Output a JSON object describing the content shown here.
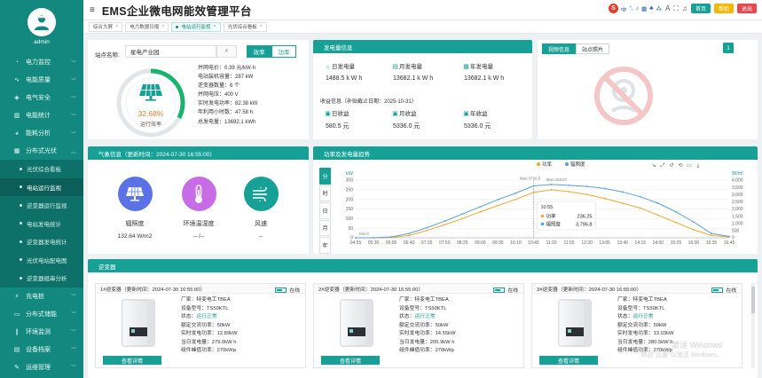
{
  "user": {
    "name": "admin"
  },
  "app": {
    "title": "EMS企业微电网能效管理平台"
  },
  "sidebar": {
    "items": [
      {
        "label": "电力监控",
        "icon": "gauge-icon"
      },
      {
        "label": "电能质量",
        "icon": "wave-icon"
      },
      {
        "label": "电气安全",
        "icon": "shield-icon"
      },
      {
        "label": "电能统计",
        "icon": "bar-chart-icon"
      },
      {
        "label": "能耗分析",
        "icon": "pie-icon"
      },
      {
        "label": "分布式光伏",
        "icon": "solar-icon",
        "expanded": true
      }
    ],
    "pv_sub": [
      {
        "label": "光伏综合看板"
      },
      {
        "label": "电站运行监视",
        "active": true
      },
      {
        "label": "逆变器运行监视"
      },
      {
        "label": "电站发电统计"
      },
      {
        "label": "逆变器发电统计"
      },
      {
        "label": "光伏电站配电图"
      },
      {
        "label": "逆变器组串分析"
      }
    ],
    "items_after": [
      {
        "label": "充电桩",
        "icon": "charger-icon"
      },
      {
        "label": "分布式储能",
        "icon": "battery-icon"
      },
      {
        "label": "环境监测",
        "icon": "thermometer-icon"
      },
      {
        "label": "设备档案",
        "icon": "archive-icon"
      },
      {
        "label": "运维管理",
        "icon": "wrench-icon"
      }
    ]
  },
  "topbar": {
    "ime_label": "中",
    "buttons": [
      {
        "label": "首页",
        "color": "#17a096"
      },
      {
        "label": "帮助",
        "color": "#f5b800"
      },
      {
        "label": "退出",
        "color": "#e5484d"
      }
    ]
  },
  "tabs": [
    {
      "label": "综合大屏"
    },
    {
      "label": "电力数据日报"
    },
    {
      "label": "电站运行监视",
      "active": true
    },
    {
      "label": "光伏综合看板"
    }
  ],
  "station": {
    "label": "站点名称:",
    "name": "星电产业园",
    "seg_efficiency": "效率",
    "seg_power": "功率",
    "efficiency": 32.68,
    "efficiency_text": "32.68%",
    "efficiency_label": "运行效率",
    "info": [
      "并网电价：0.39 元/kW·h",
      "电站装机容量：287 kW",
      "逆变器数量：6 个",
      "并网电压：400 V",
      "实时发电功率：82.38 kW",
      "年利用小时数：47.58 h",
      "总发电量：13682.1 kWh"
    ]
  },
  "power_info": {
    "title": "发电量信息",
    "gen": [
      {
        "label": "日发电量",
        "value": "1488.5 k W h"
      },
      {
        "label": "月发电量",
        "value": "13682.1 k W h"
      },
      {
        "label": "年发电量",
        "value": "13682.1 k W h"
      }
    ],
    "income_title": "收益信息（补贴截止日期：2025-10-31）",
    "income": [
      {
        "label": "日收益",
        "value": "580.5 元"
      },
      {
        "label": "月收益",
        "value": "5336.0 元"
      },
      {
        "label": "年收益",
        "value": "5336.0 元"
      }
    ]
  },
  "video": {
    "tab_info": "视频信息",
    "tab_photo": "站点照片",
    "badge": "1"
  },
  "weather": {
    "title": "气象信息（更新时间：2024-07-30 16:55:00）",
    "items": [
      {
        "name": "辐照度",
        "value": "132.64 W/m2",
        "color": "#5b72e6"
      },
      {
        "name": "环境温湿度",
        "value": "-- /--",
        "color": "#c86be6"
      },
      {
        "name": "风速",
        "value": "--",
        "color": "#17a096"
      }
    ]
  },
  "chart_panel": {
    "title": "功率及发电量趋势",
    "side_tabs": [
      "分",
      "时",
      "日",
      "月",
      "年"
    ],
    "tooltip_time": "10:55",
    "tooltip_power_label": "功率",
    "tooltip_power": "236.25",
    "tooltip_irr_label": "辐照度",
    "tooltip_irr": "3,796.8",
    "max_a": "Max:3796.8",
    "max_b": "Max:259.07",
    "min_a": "Min:0"
  },
  "chart_data": {
    "type": "line",
    "x": [
      "04:55",
      "05:30",
      "06:05",
      "06:40",
      "07:15",
      "07:50",
      "08:25",
      "09:00",
      "09:35",
      "10:10",
      "10:45",
      "11:20",
      "11:55",
      "12:30",
      "13:05",
      "13:40",
      "14:15",
      "14:50",
      "15:25",
      "16:00",
      "16:35",
      "16:45"
    ],
    "series": [
      {
        "name": "功率",
        "axis": "left",
        "unit": "kW",
        "color": "#f0a830",
        "values": [
          0,
          0,
          2,
          12,
          38,
          68,
          100,
          135,
          168,
          200,
          236,
          250,
          240,
          225,
          205,
          180,
          155,
          118,
          80,
          42,
          12,
          4
        ]
      },
      {
        "name": "辐照度",
        "axis": "right",
        "unit": "W/m²",
        "color": "#5aa0d8",
        "values": [
          0,
          0,
          60,
          300,
          700,
          1150,
          1650,
          2150,
          2650,
          3100,
          3600,
          3700,
          3640,
          3560,
          3420,
          3180,
          2850,
          2400,
          1800,
          1100,
          300,
          100
        ]
      }
    ],
    "ylabel_left": "kW",
    "ylabel_right": "W/m²",
    "ylim_left": [
      0,
      300
    ],
    "ylim_right": [
      0,
      4000
    ],
    "yticks_left": [
      0,
      50,
      100,
      150,
      200,
      250,
      300
    ],
    "yticks_right": [
      0,
      500,
      1000,
      1500,
      2000,
      2500,
      3000,
      3500,
      4000
    ],
    "legend": "top",
    "grid": true
  },
  "inverters": {
    "title": "逆变器",
    "online_label": "在线",
    "detail_label": "查看详情",
    "items": [
      {
        "header": "1#逆变器（更新时间：2024-07-30 16:55:00）",
        "maker": "厂家：特变电工TBEA",
        "model": "设备型号：TS50KTL",
        "status_prefix": "状态：",
        "status": "运行正常",
        "rated": "额定交流功率：50kW",
        "realtime": "实时发电功率：12.89kW",
        "today": "当日发电量：279.0kW h",
        "pv": "组件峰值功率：270kWp"
      },
      {
        "header": "2#逆变器（更新时间：2024-07-30 16:55:00）",
        "maker": "厂家：特变电工TBEA",
        "model": "设备型号：TS50KTL",
        "status_prefix": "状态：",
        "status": "运行正常",
        "rated": "额定交流功率：50kW",
        "realtime": "实时发电功率：14.55kW",
        "today": "当日发电量：206.9kW h",
        "pv": "组件峰值功率：270kWp"
      },
      {
        "header": "3#逆变器（更新时间：2024-07-30 16:55:00）",
        "maker": "厂家：特变电工TBEA",
        "model": "设备型号：TS50KTL",
        "status_prefix": "状态：",
        "status": "运行正常",
        "rated": "额定交流功率：50kW",
        "realtime": "实时发电功率：13.03kW",
        "today": "当日发电量：280.5kW h",
        "pv": "组件峰值功率：270kWp"
      }
    ]
  },
  "watermark": {
    "line1": "激活 Windows",
    "line2": "转到\"设置\"以激活 Windows。"
  }
}
